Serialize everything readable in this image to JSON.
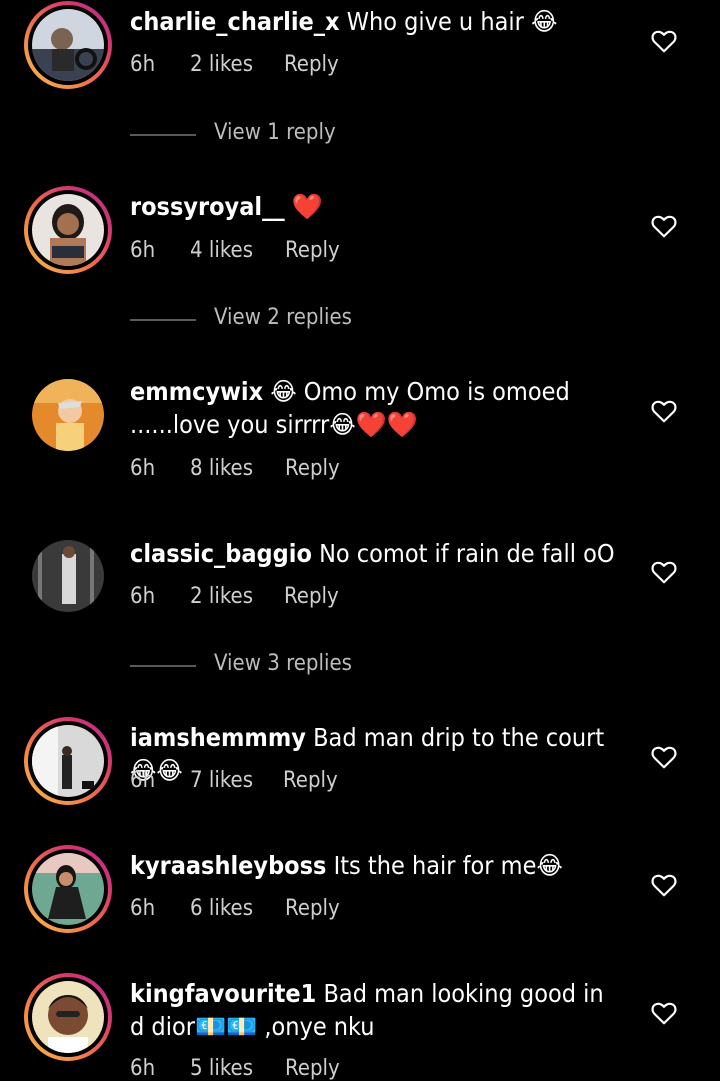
{
  "comments": [
    {
      "username": "charlie_charlie_x",
      "text": "Who give u hair 😂",
      "time": "6h",
      "likes": "2 likes",
      "reply": "Reply",
      "has_story_ring": true,
      "avatar_color": "#8a9bb5"
    },
    {
      "username": "rossyroyal__",
      "text": "❤️",
      "time": "6h",
      "likes": "4 likes",
      "reply": "Reply",
      "has_story_ring": true,
      "avatar_color": "#c99a82"
    },
    {
      "username": "emmcywix",
      "text": "😂 Omo my Omo is omoed ......love you sirrrr😂❤️❤️",
      "time": "6h",
      "likes": "8 likes",
      "reply": "Reply",
      "has_story_ring": false,
      "avatar_color": "#e58a2c"
    },
    {
      "username": "classic_baggio",
      "text": "No comot if rain de fall oO",
      "time": "6h",
      "likes": "2 likes",
      "reply": "Reply",
      "has_story_ring": false,
      "avatar_color": "#6a6a6a"
    },
    {
      "username": "iamshemmmy",
      "text": "Bad man drip to the court😂😂",
      "time": "6h",
      "likes": "7 likes",
      "reply": "Reply",
      "has_story_ring": true,
      "avatar_color": "#b8b8b8"
    },
    {
      "username": "kyraashleyboss",
      "text": "Its the hair for me😂",
      "time": "6h",
      "likes": "6 likes",
      "reply": "Reply",
      "has_story_ring": true,
      "avatar_color": "#6ea893"
    },
    {
      "username": "kingfavourite1",
      "text": "Bad man looking good in d dior💶💶 ,onye nku",
      "time": "6h",
      "likes": "5 likes",
      "reply": "Reply",
      "has_story_ring": true,
      "avatar_color": "#e8d7a8"
    }
  ],
  "view_replies": [
    "View 1 reply",
    "View 2 replies",
    "View 3 replies"
  ],
  "icons": {
    "like": "heart-outline-icon"
  }
}
